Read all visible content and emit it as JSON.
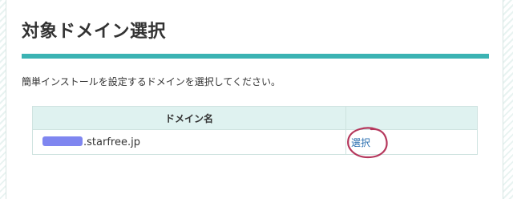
{
  "page": {
    "title": "対象ドメイン選択",
    "intro": "簡単インストールを設定するドメインを選択してください。"
  },
  "table": {
    "headers": [
      "ドメイン名",
      ""
    ],
    "rows": [
      {
        "domain_suffix": ".starfree.jp",
        "action_label": "選択"
      }
    ]
  },
  "colors": {
    "accent": "#3bb3b3",
    "header_bg": "#dff2f0",
    "link": "#2a6fb0",
    "mask": "#7f86f0",
    "annotation": "#b5375c"
  }
}
